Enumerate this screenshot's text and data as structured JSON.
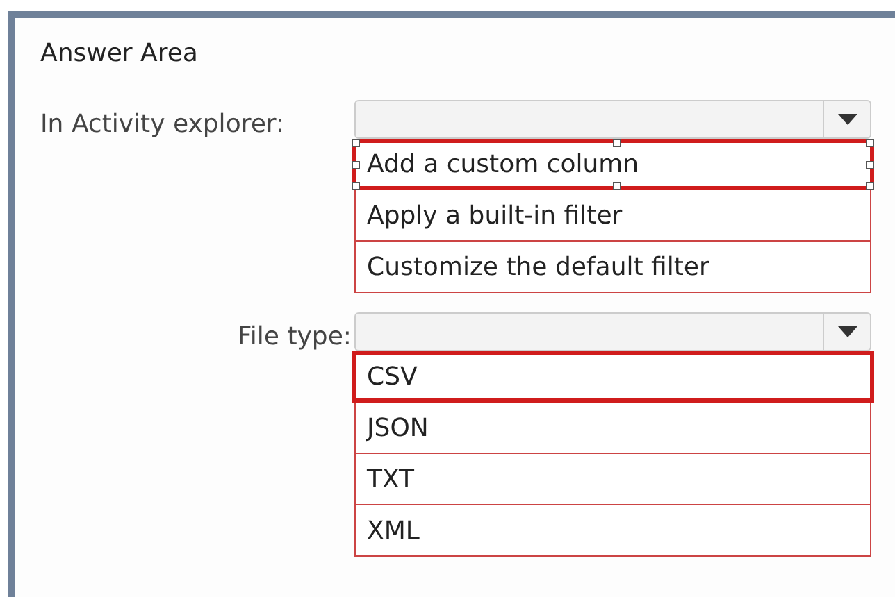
{
  "title": "Answer Area",
  "rows": [
    {
      "label": "In Activity explorer:",
      "resize_handles": true,
      "options": [
        {
          "label": "Add a custom column",
          "selected": true
        },
        {
          "label": "Apply a built-in filter",
          "selected": false
        },
        {
          "label": "Customize the default filter",
          "selected": false
        }
      ]
    },
    {
      "label": "File type:",
      "resize_handles": false,
      "options": [
        {
          "label": "CSV",
          "selected": true
        },
        {
          "label": "JSON",
          "selected": false
        },
        {
          "label": "TXT",
          "selected": false
        },
        {
          "label": "XML",
          "selected": false
        }
      ]
    }
  ]
}
